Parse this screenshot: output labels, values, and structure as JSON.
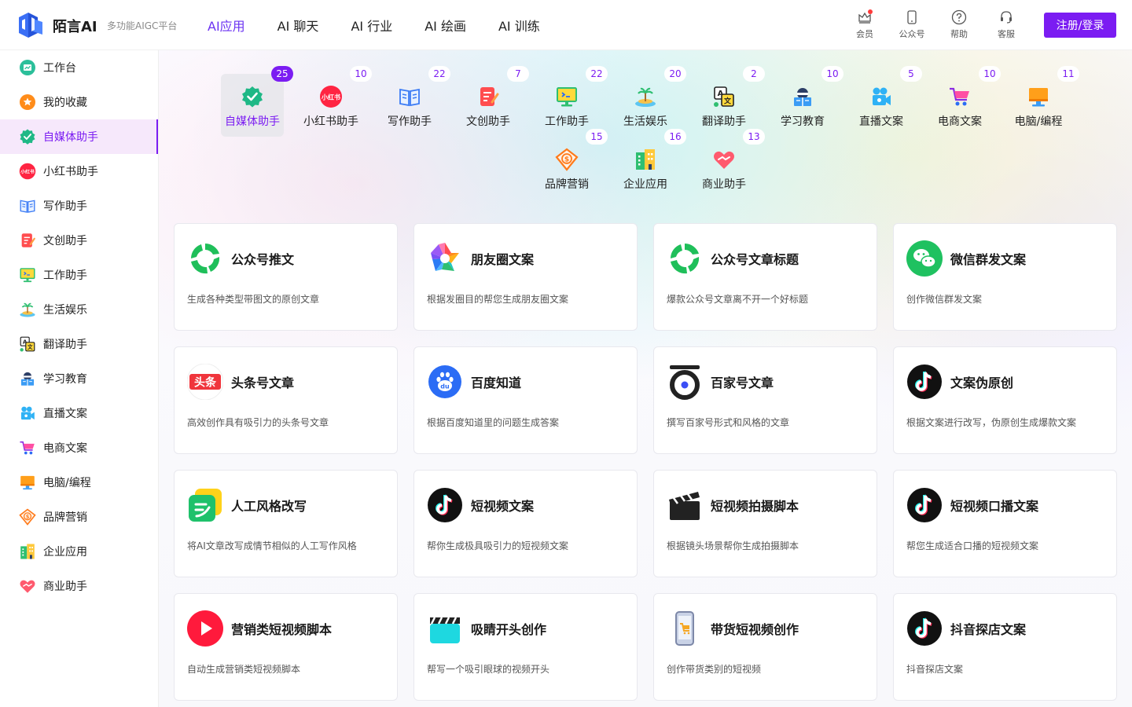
{
  "brand": {
    "name": "陌言AI",
    "tagline": "多功能AIGC平台"
  },
  "nav": [
    {
      "label": "AI应用",
      "active": true
    },
    {
      "label": "AI 聊天"
    },
    {
      "label": "AI 行业"
    },
    {
      "label": "AI 绘画"
    },
    {
      "label": "AI 训练"
    }
  ],
  "header_icons": [
    {
      "label": "会员",
      "icon": "crown-icon"
    },
    {
      "label": "公众号",
      "icon": "phone-icon"
    },
    {
      "label": "帮助",
      "icon": "help-icon"
    },
    {
      "label": "客服",
      "icon": "headset-icon"
    }
  ],
  "login_label": "注册/登录",
  "sidebar": [
    {
      "label": "工作台",
      "icon": "dashboard-icon"
    },
    {
      "label": "我的收藏",
      "icon": "star-icon"
    },
    {
      "label": "自媒体助手",
      "icon": "media-icon",
      "active": true
    },
    {
      "label": "小红书助手",
      "icon": "xiaohongshu-icon"
    },
    {
      "label": "写作助手",
      "icon": "book-icon"
    },
    {
      "label": "文创助手",
      "icon": "note-icon"
    },
    {
      "label": "工作助手",
      "icon": "monitor-icon"
    },
    {
      "label": "生活娱乐",
      "icon": "island-icon"
    },
    {
      "label": "翻译助手",
      "icon": "translate-icon"
    },
    {
      "label": "学习教育",
      "icon": "student-icon"
    },
    {
      "label": "直播文案",
      "icon": "camera-icon"
    },
    {
      "label": "电商文案",
      "icon": "cart-icon"
    },
    {
      "label": "电脑/编程",
      "icon": "computer-icon"
    },
    {
      "label": "品牌营销",
      "icon": "brand-icon"
    },
    {
      "label": "企业应用",
      "icon": "building-icon"
    },
    {
      "label": "商业助手",
      "icon": "handshake-icon"
    }
  ],
  "categories": [
    {
      "label": "自媒体助手",
      "count": "25",
      "icon": "media-icon",
      "active": true
    },
    {
      "label": "小红书助手",
      "count": "10",
      "icon": "xiaohongshu-icon"
    },
    {
      "label": "写作助手",
      "count": "22",
      "icon": "book-icon"
    },
    {
      "label": "文创助手",
      "count": "7",
      "icon": "note-icon"
    },
    {
      "label": "工作助手",
      "count": "22",
      "icon": "monitor-icon"
    },
    {
      "label": "生活娱乐",
      "count": "20",
      "icon": "island-icon"
    },
    {
      "label": "翻译助手",
      "count": "2",
      "icon": "translate-icon"
    },
    {
      "label": "学习教育",
      "count": "10",
      "icon": "student-icon"
    },
    {
      "label": "直播文案",
      "count": "5",
      "icon": "camera-icon"
    },
    {
      "label": "电商文案",
      "count": "10",
      "icon": "cart-icon"
    },
    {
      "label": "电脑/编程",
      "count": "11",
      "icon": "computer-icon"
    },
    {
      "label": "品牌营销",
      "count": "15",
      "icon": "brand-icon"
    },
    {
      "label": "企业应用",
      "count": "16",
      "icon": "building-icon"
    },
    {
      "label": "商业助手",
      "count": "13",
      "icon": "handshake-icon"
    }
  ],
  "cards": [
    {
      "title": "公众号推文",
      "desc": "生成各种类型带图文的原创文章",
      "icon": "wechat-official-icon"
    },
    {
      "title": "朋友圈文案",
      "desc": "根据发圈目的帮您生成朋友圈文案",
      "icon": "moments-icon"
    },
    {
      "title": "公众号文章标题",
      "desc": "爆款公众号文章离不开一个好标题",
      "icon": "wechat-official-icon"
    },
    {
      "title": "微信群发文案",
      "desc": "创作微信群发文案",
      "icon": "wechat-icon"
    },
    {
      "title": "头条号文章",
      "desc": "高效创作具有吸引力的头条号文章",
      "icon": "toutiao-icon"
    },
    {
      "title": "百度知道",
      "desc": "根据百度知道里的问题生成答案",
      "icon": "baidu-icon"
    },
    {
      "title": "百家号文章",
      "desc": "撰写百家号形式和风格的文章",
      "icon": "baijiahao-icon"
    },
    {
      "title": "文案伪原创",
      "desc": "根据文案进行改写，伪原创生成爆款文案",
      "icon": "tiktok-icon"
    },
    {
      "title": "人工风格改写",
      "desc": "将AI文章改写成情节相似的人工写作风格",
      "icon": "rewrite-icon"
    },
    {
      "title": "短视频文案",
      "desc": "帮你生成极具吸引力的短视频文案",
      "icon": "tiktok-icon"
    },
    {
      "title": "短视频拍摄脚本",
      "desc": "根据镜头场景帮你生成拍摄脚本",
      "icon": "clapper-icon"
    },
    {
      "title": "短视频口播文案",
      "desc": "帮您生成适合口播的短视频文案",
      "icon": "tiktok-icon"
    },
    {
      "title": "营销类短视频脚本",
      "desc": "自动生成营销类短视频脚本",
      "icon": "play-icon"
    },
    {
      "title": "吸睛开头创作",
      "desc": "帮写一个吸引眼球的视频开头",
      "icon": "clapper-cyan-icon"
    },
    {
      "title": "带货短视频创作",
      "desc": "创作带货类别的短视频",
      "icon": "phone-cart-icon"
    },
    {
      "title": "抖音探店文案",
      "desc": "抖音探店文案",
      "icon": "tiktok-icon"
    }
  ],
  "colors": {
    "accent": "#7b1cf2",
    "active_bg": "#f6e8fb"
  }
}
